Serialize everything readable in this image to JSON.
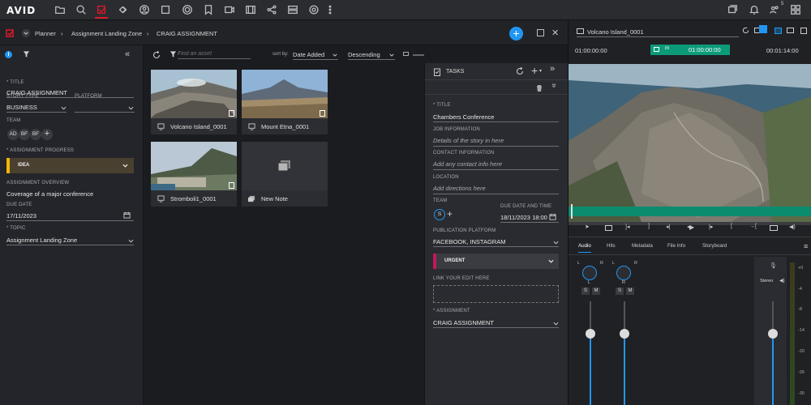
{
  "app": {
    "logo": "AVID"
  },
  "topbar": {
    "icons": [
      "folder-icon",
      "search-icon",
      "planner-icon",
      "links-icon",
      "user-icon",
      "stop-icon",
      "disc-icon",
      "bookmark-icon",
      "media-icon",
      "film-icon",
      "share-icon",
      "layout-icon",
      "settings-icon",
      "more-icon"
    ],
    "right_icons": [
      "chat-icon",
      "bell-icon",
      "people-icon",
      "grid-icon"
    ],
    "people_count": "5"
  },
  "breadcrumb": {
    "items": [
      "Planner",
      "Assignment Landing Zone",
      "CRAIG ASSIGNMENT"
    ]
  },
  "left_panel": {
    "title_label": "* TITLE",
    "title_value": "CRAIG ASSIGNMENT",
    "story_type_label": "STORY TYPE",
    "story_type_value": "BUSINESS",
    "platform_label": "PLATFORM",
    "platform_value": "",
    "team_label": "TEAM",
    "team_members": [
      "AD",
      "BF",
      "BF"
    ],
    "progress_label": "* ASSIGNMENT PROGRESS",
    "progress_value": "IDEA",
    "overview_label": "ASSIGNMENT OVERVIEW",
    "overview_value": "Coverage of a major conference",
    "due_label": "DUE DATE",
    "due_value": "17/11/2023",
    "topic_label": "* TOPIC",
    "topic_value": "Assignment Landing Zone"
  },
  "asset_toolbar": {
    "search_placeholder": "Find an asset",
    "sort_label": "sort by:",
    "sort_value": "Date Added",
    "order_value": "Descending"
  },
  "assets": [
    {
      "name": "Volcano Island_0001",
      "type": "video"
    },
    {
      "name": "Mount Etna_0001",
      "type": "video"
    },
    {
      "name": "Stromboli1_0001",
      "type": "video"
    },
    {
      "name": "New Note",
      "type": "note"
    }
  ],
  "tasks": {
    "header": "TASKS",
    "title_label": "* TITLE",
    "title_value": "Chambers Conference",
    "job_label": "JOB INFORMATION",
    "job_placeholder": "Details of the story in here",
    "contact_label": "CONTACT INFORMATION",
    "contact_placeholder": "Add any contact info here",
    "location_label": "LOCATION",
    "location_placeholder": "Add directions here",
    "team_label": "TEAM",
    "team_member": "S",
    "due_label": "DUE DATE AND TIME",
    "due_value": "18/11/2023 18:00",
    "platform_label": "PUBLICATION PLATFORM",
    "platform_value": "FACEBOOK, INSTAGRAM",
    "priority_value": "URGENT",
    "link_label": "LINK YOUR EDIT HERE",
    "assignment_label": "* ASSIGNMENT",
    "assignment_value": "CRAIG ASSIGNMENT"
  },
  "monitor": {
    "clip_name": "Volcano Island_0001",
    "tc_in": "01:00:00:00",
    "tc_center": "01:00:00:00",
    "tc_mode": "m",
    "tc_out": "00:01:14:00",
    "tabs": [
      "Audio",
      "Hits",
      "Metadata",
      "File Info",
      "Storyboard"
    ],
    "channels": [
      {
        "left": "L",
        "right": "R",
        "label": "L"
      },
      {
        "left": "L",
        "right": "R",
        "label": "R"
      }
    ],
    "solo": "S",
    "mute": "M",
    "stereo_label": "Stereo",
    "meter_scale": [
      "+0",
      "-4",
      "-8",
      "-14",
      "-20",
      "-26",
      "-30"
    ]
  },
  "colors": {
    "accent": "#2196f3",
    "brand_red": "#e0192b",
    "green": "#0c9b79",
    "urgent": "#c2185b",
    "idea": "#f2b705"
  }
}
